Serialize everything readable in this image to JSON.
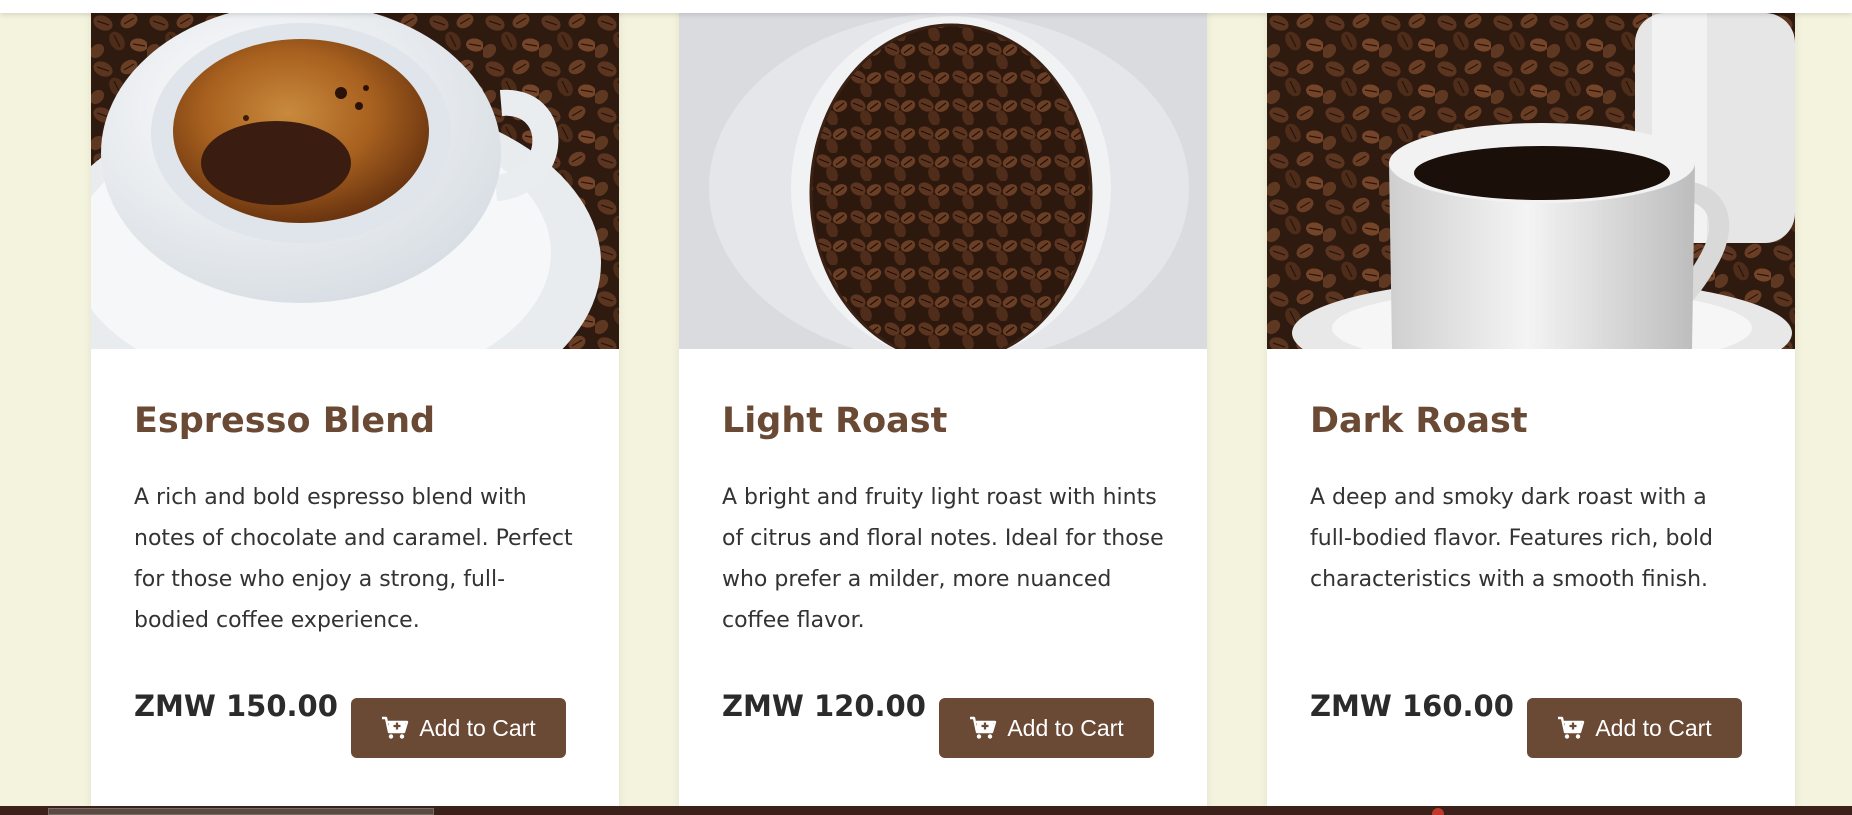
{
  "products": [
    {
      "title": "Espresso Blend",
      "description": "A rich and bold espresso blend with notes of chocolate and caramel. Perfect for those who enjoy a strong, full-bodied coffee experience.",
      "price": "ZMW 150.00",
      "button_label": "Add to Cart",
      "image_alt": "Espresso cup on saucer with coffee beans"
    },
    {
      "title": "Light Roast",
      "description": "A bright and fruity light roast with hints of citrus and floral notes. Ideal for those who prefer a milder, more nuanced coffee flavor.",
      "price": "ZMW 120.00",
      "button_label": "Add to Cart",
      "image_alt": "Bowl of roasted coffee beans"
    },
    {
      "title": "Dark Roast",
      "description": "A deep and smoky dark roast with a full-bodied flavor. Features rich, bold characteristics with a smooth finish.",
      "price": "ZMW 160.00",
      "button_label": "Add to Cart",
      "image_alt": "White coffee cup on saucer over coffee beans"
    }
  ],
  "colors": {
    "page_background": "#f4f4de",
    "brand_brown": "#6b4a35",
    "footer": "#3b2119"
  },
  "icons": {
    "cart": "cart-plus-icon"
  }
}
